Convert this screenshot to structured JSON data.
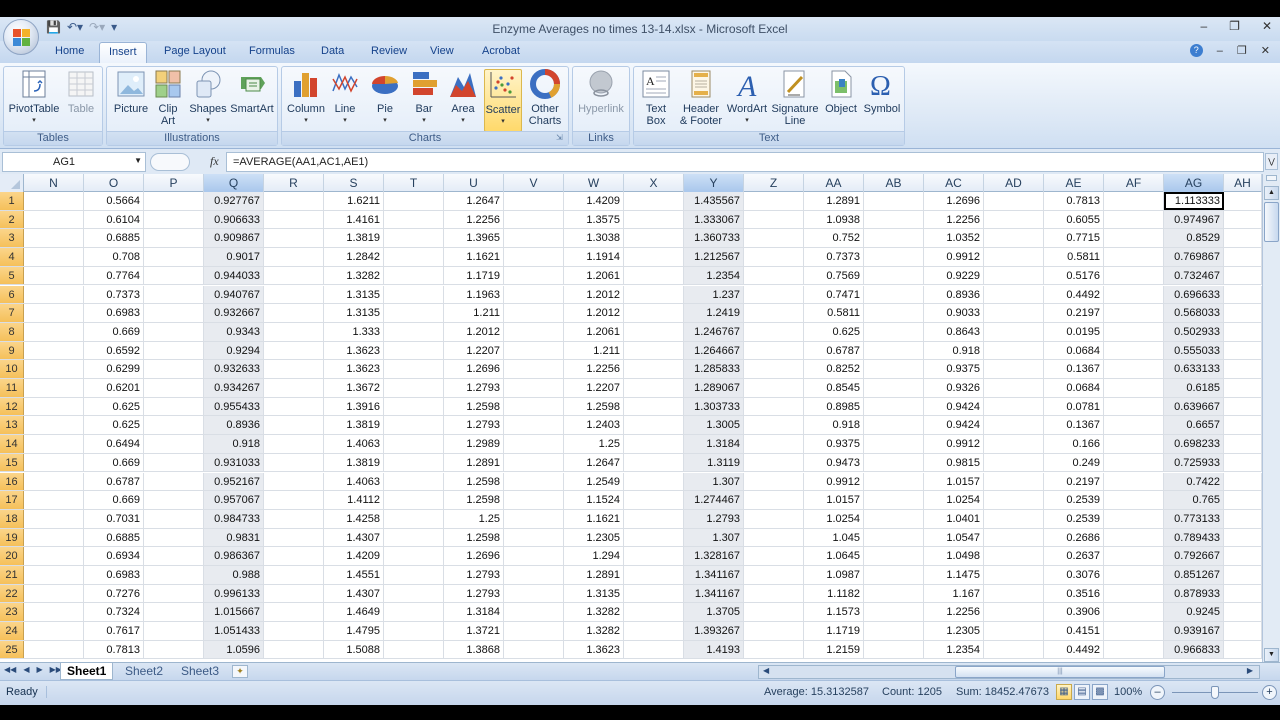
{
  "window": {
    "title": "Enzyme Averages no times  13-14.xlsx - Microsoft Excel",
    "controls": [
      "minimize",
      "restore",
      "close"
    ]
  },
  "quick_access": [
    "save-icon",
    "undo-icon",
    "redo-icon",
    "customize-icon"
  ],
  "tabs": [
    {
      "label": "Home",
      "active": false
    },
    {
      "label": "Insert",
      "active": true
    },
    {
      "label": "Page Layout",
      "active": false
    },
    {
      "label": "Formulas",
      "active": false
    },
    {
      "label": "Data",
      "active": false
    },
    {
      "label": "Review",
      "active": false
    },
    {
      "label": "View",
      "active": false
    },
    {
      "label": "Acrobat",
      "active": false
    }
  ],
  "ribbon": {
    "groups": [
      {
        "label": "Tables",
        "buttons": [
          {
            "label": "PivotTable",
            "icon": "pivottable-icon",
            "dropdown": true
          },
          {
            "label": "Table",
            "icon": "table-icon",
            "dropdown": false
          }
        ]
      },
      {
        "label": "Illustrations",
        "buttons": [
          {
            "label": "Picture",
            "icon": "picture-icon",
            "dropdown": false
          },
          {
            "label": "Clip Art",
            "icon": "clipart-icon",
            "dropdown": false
          },
          {
            "label": "Shapes",
            "icon": "shapes-icon",
            "dropdown": true
          },
          {
            "label": "SmartArt",
            "icon": "smartart-icon",
            "dropdown": false
          }
        ]
      },
      {
        "label": "Charts",
        "buttons": [
          {
            "label": "Column",
            "icon": "column-chart-icon",
            "dropdown": true
          },
          {
            "label": "Line",
            "icon": "line-chart-icon",
            "dropdown": true
          },
          {
            "label": "Pie",
            "icon": "pie-chart-icon",
            "dropdown": true
          },
          {
            "label": "Bar",
            "icon": "bar-chart-icon",
            "dropdown": true
          },
          {
            "label": "Area",
            "icon": "area-chart-icon",
            "dropdown": true
          },
          {
            "label": "Scatter",
            "icon": "scatter-chart-icon",
            "dropdown": true,
            "hover": true
          },
          {
            "label": "Other Charts",
            "icon": "other-charts-icon",
            "dropdown": true
          }
        ]
      },
      {
        "label": "Links",
        "buttons": [
          {
            "label": "Hyperlink",
            "icon": "hyperlink-icon",
            "dropdown": false,
            "disabled": true
          }
        ]
      },
      {
        "label": "Text",
        "buttons": [
          {
            "label": "Text Box",
            "icon": "textbox-icon",
            "dropdown": false
          },
          {
            "label": "Header & Footer",
            "icon": "header-footer-icon",
            "dropdown": false
          },
          {
            "label": "WordArt",
            "icon": "wordart-icon",
            "dropdown": true
          },
          {
            "label": "Signature Line",
            "icon": "signature-line-icon",
            "dropdown": true
          },
          {
            "label": "Object",
            "icon": "object-icon",
            "dropdown": false
          },
          {
            "label": "Symbol",
            "icon": "symbol-icon",
            "dropdown": false
          }
        ]
      }
    ]
  },
  "formula_bar": {
    "name_box": "AG1",
    "fx_label": "fx",
    "formula": "=AVERAGE(AA1,AC1,AE1)"
  },
  "sheet": {
    "columns": [
      "N",
      "O",
      "P",
      "Q",
      "R",
      "S",
      "T",
      "U",
      "V",
      "W",
      "X",
      "Y",
      "Z",
      "AA",
      "AB",
      "AC",
      "AD",
      "AE",
      "AF",
      "AG",
      "AH"
    ],
    "selected_columns": [
      "Q",
      "Y",
      "AG"
    ],
    "active_cell": "AG1",
    "rows": [
      {
        "n": "1",
        "O": "0.5664",
        "Q": "0.927767",
        "S": "1.6211",
        "U": "1.2647",
        "W": "1.4209",
        "Y": "1.435567",
        "AA": "1.2891",
        "AC": "1.2696",
        "AE": "0.7813",
        "AG": "1.113333"
      },
      {
        "n": "2",
        "O": "0.6104",
        "Q": "0.906633",
        "S": "1.4161",
        "U": "1.2256",
        "W": "1.3575",
        "Y": "1.333067",
        "AA": "1.0938",
        "AC": "1.2256",
        "AE": "0.6055",
        "AG": "0.974967"
      },
      {
        "n": "3",
        "O": "0.6885",
        "Q": "0.909867",
        "S": "1.3819",
        "U": "1.3965",
        "W": "1.3038",
        "Y": "1.360733",
        "AA": "0.752",
        "AC": "1.0352",
        "AE": "0.7715",
        "AG": "0.8529"
      },
      {
        "n": "4",
        "O": "0.708",
        "Q": "0.9017",
        "S": "1.2842",
        "U": "1.1621",
        "W": "1.1914",
        "Y": "1.212567",
        "AA": "0.7373",
        "AC": "0.9912",
        "AE": "0.5811",
        "AG": "0.769867"
      },
      {
        "n": "5",
        "O": "0.7764",
        "Q": "0.944033",
        "S": "1.3282",
        "U": "1.1719",
        "W": "1.2061",
        "Y": "1.2354",
        "AA": "0.7569",
        "AC": "0.9229",
        "AE": "0.5176",
        "AG": "0.732467"
      },
      {
        "n": "6",
        "O": "0.7373",
        "Q": "0.940767",
        "S": "1.3135",
        "U": "1.1963",
        "W": "1.2012",
        "Y": "1.237",
        "AA": "0.7471",
        "AC": "0.8936",
        "AE": "0.4492",
        "AG": "0.696633"
      },
      {
        "n": "7",
        "O": "0.6983",
        "Q": "0.932667",
        "S": "1.3135",
        "U": "1.211",
        "W": "1.2012",
        "Y": "1.2419",
        "AA": "0.5811",
        "AC": "0.9033",
        "AE": "0.2197",
        "AG": "0.568033"
      },
      {
        "n": "8",
        "O": "0.669",
        "Q": "0.9343",
        "S": "1.333",
        "U": "1.2012",
        "W": "1.2061",
        "Y": "1.246767",
        "AA": "0.625",
        "AC": "0.8643",
        "AE": "0.0195",
        "AG": "0.502933"
      },
      {
        "n": "9",
        "O": "0.6592",
        "Q": "0.9294",
        "S": "1.3623",
        "U": "1.2207",
        "W": "1.211",
        "Y": "1.264667",
        "AA": "0.6787",
        "AC": "0.918",
        "AE": "0.0684",
        "AG": "0.555033"
      },
      {
        "n": "10",
        "O": "0.6299",
        "Q": "0.932633",
        "S": "1.3623",
        "U": "1.2696",
        "W": "1.2256",
        "Y": "1.285833",
        "AA": "0.8252",
        "AC": "0.9375",
        "AE": "0.1367",
        "AG": "0.633133"
      },
      {
        "n": "11",
        "O": "0.6201",
        "Q": "0.934267",
        "S": "1.3672",
        "U": "1.2793",
        "W": "1.2207",
        "Y": "1.289067",
        "AA": "0.8545",
        "AC": "0.9326",
        "AE": "0.0684",
        "AG": "0.6185"
      },
      {
        "n": "12",
        "O": "0.625",
        "Q": "0.955433",
        "S": "1.3916",
        "U": "1.2598",
        "W": "1.2598",
        "Y": "1.303733",
        "AA": "0.8985",
        "AC": "0.9424",
        "AE": "0.0781",
        "AG": "0.639667"
      },
      {
        "n": "13",
        "O": "0.625",
        "Q": "0.8936",
        "S": "1.3819",
        "U": "1.2793",
        "W": "1.2403",
        "Y": "1.3005",
        "AA": "0.918",
        "AC": "0.9424",
        "AE": "0.1367",
        "AG": "0.6657"
      },
      {
        "n": "14",
        "O": "0.6494",
        "Q": "0.918",
        "S": "1.4063",
        "U": "1.2989",
        "W": "1.25",
        "Y": "1.3184",
        "AA": "0.9375",
        "AC": "0.9912",
        "AE": "0.166",
        "AG": "0.698233"
      },
      {
        "n": "15",
        "O": "0.669",
        "Q": "0.931033",
        "S": "1.3819",
        "U": "1.2891",
        "W": "1.2647",
        "Y": "1.3119",
        "AA": "0.9473",
        "AC": "0.9815",
        "AE": "0.249",
        "AG": "0.725933"
      },
      {
        "n": "16",
        "O": "0.6787",
        "Q": "0.952167",
        "S": "1.4063",
        "U": "1.2598",
        "W": "1.2549",
        "Y": "1.307",
        "AA": "0.9912",
        "AC": "1.0157",
        "AE": "0.2197",
        "AG": "0.7422"
      },
      {
        "n": "17",
        "O": "0.669",
        "Q": "0.957067",
        "S": "1.4112",
        "U": "1.2598",
        "W": "1.1524",
        "Y": "1.274467",
        "AA": "1.0157",
        "AC": "1.0254",
        "AE": "0.2539",
        "AG": "0.765"
      },
      {
        "n": "18",
        "O": "0.7031",
        "Q": "0.984733",
        "S": "1.4258",
        "U": "1.25",
        "W": "1.1621",
        "Y": "1.2793",
        "AA": "1.0254",
        "AC": "1.0401",
        "AE": "0.2539",
        "AG": "0.773133"
      },
      {
        "n": "19",
        "O": "0.6885",
        "Q": "0.9831",
        "S": "1.4307",
        "U": "1.2598",
        "W": "1.2305",
        "Y": "1.307",
        "AA": "1.045",
        "AC": "1.0547",
        "AE": "0.2686",
        "AG": "0.789433"
      },
      {
        "n": "20",
        "O": "0.6934",
        "Q": "0.986367",
        "S": "1.4209",
        "U": "1.2696",
        "W": "1.294",
        "Y": "1.328167",
        "AA": "1.0645",
        "AC": "1.0498",
        "AE": "0.2637",
        "AG": "0.792667"
      },
      {
        "n": "21",
        "O": "0.6983",
        "Q": "0.988",
        "S": "1.4551",
        "U": "1.2793",
        "W": "1.2891",
        "Y": "1.341167",
        "AA": "1.0987",
        "AC": "1.1475",
        "AE": "0.3076",
        "AG": "0.851267"
      },
      {
        "n": "22",
        "O": "0.7276",
        "Q": "0.996133",
        "S": "1.4307",
        "U": "1.2793",
        "W": "1.3135",
        "Y": "1.341167",
        "AA": "1.1182",
        "AC": "1.167",
        "AE": "0.3516",
        "AG": "0.878933"
      },
      {
        "n": "23",
        "O": "0.7324",
        "Q": "1.015667",
        "S": "1.4649",
        "U": "1.3184",
        "W": "1.3282",
        "Y": "1.3705",
        "AA": "1.1573",
        "AC": "1.2256",
        "AE": "0.3906",
        "AG": "0.9245"
      },
      {
        "n": "24",
        "O": "0.7617",
        "Q": "1.051433",
        "S": "1.4795",
        "U": "1.3721",
        "W": "1.3282",
        "Y": "1.393267",
        "AA": "1.1719",
        "AC": "1.2305",
        "AE": "0.4151",
        "AG": "0.939167"
      },
      {
        "n": "25",
        "O": "0.7813",
        "Q": "1.0596",
        "S": "1.5088",
        "U": "1.3868",
        "W": "1.3623",
        "Y": "1.4193",
        "AA": "1.2159",
        "AC": "1.2354",
        "AE": "0.4492",
        "AG": "0.966833"
      }
    ]
  },
  "sheet_tabs": [
    {
      "label": "Sheet1",
      "active": true
    },
    {
      "label": "Sheet2",
      "active": false
    },
    {
      "label": "Sheet3",
      "active": false
    }
  ],
  "status_bar": {
    "mode": "Ready",
    "average": "Average: 15.3132587",
    "count": "Count: 1205",
    "sum": "Sum: 18452.47673",
    "zoom": "100%",
    "zoom_fraction": 0.5
  }
}
